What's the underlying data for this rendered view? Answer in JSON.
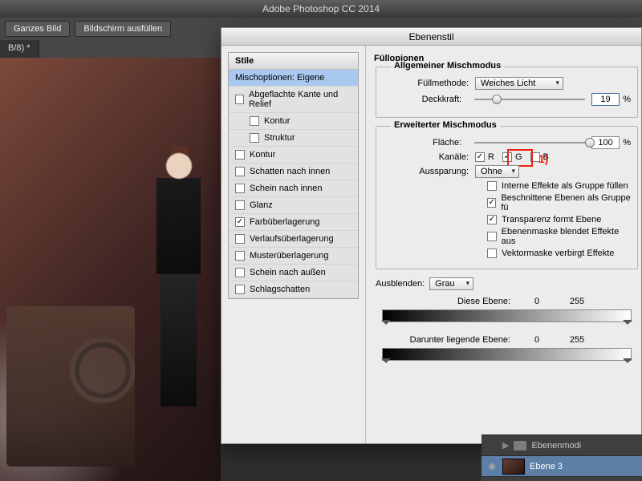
{
  "app": {
    "title": "Adobe Photoshop CC 2014"
  },
  "toolbar": {
    "ganzes_bild": "Ganzes Bild",
    "bildschirm": "Bildschirm ausfüllen"
  },
  "doc_tab": "B/8) *",
  "dialog": {
    "title": "Ebenenstil",
    "styles_header": "Stile",
    "styles": [
      {
        "label": "Mischoptionen: Eigene",
        "checked": null,
        "selected": true,
        "indent": 0
      },
      {
        "label": "Abgeflachte Kante und Relief",
        "checked": false,
        "indent": 0
      },
      {
        "label": "Kontur",
        "checked": false,
        "indent": 1
      },
      {
        "label": "Struktur",
        "checked": false,
        "indent": 1
      },
      {
        "label": "Kontur",
        "checked": false,
        "indent": 0
      },
      {
        "label": "Schatten nach innen",
        "checked": false,
        "indent": 0
      },
      {
        "label": "Schein nach innen",
        "checked": false,
        "indent": 0
      },
      {
        "label": "Glanz",
        "checked": false,
        "indent": 0
      },
      {
        "label": "Farbüberlagerung",
        "checked": true,
        "indent": 0
      },
      {
        "label": "Verlaufsüberlagerung",
        "checked": false,
        "indent": 0
      },
      {
        "label": "Musterüberlagerung",
        "checked": false,
        "indent": 0
      },
      {
        "label": "Schein nach außen",
        "checked": false,
        "indent": 0
      },
      {
        "label": "Schlagschatten",
        "checked": false,
        "indent": 0
      }
    ],
    "fill_options_title": "Füllopionen",
    "general_blend_title": "Allgemeiner Mischmodus",
    "blend_mode_label": "Füllmethode:",
    "blend_mode_value": "Weiches Licht",
    "opacity_label": "Deckkraft:",
    "opacity_value": "19",
    "advanced_blend_title": "Erweiterter Mischmodus",
    "fill_label": "Fläche:",
    "fill_value": "100",
    "channels_label": "Kanäle:",
    "channel_r": "R",
    "channel_g": "G",
    "channel_b": "B",
    "channels": {
      "r": true,
      "g": true,
      "b": false
    },
    "knockout_label": "Aussparung:",
    "knockout_value": "Ohne",
    "adv_checks": [
      {
        "label": "Interne Effekte als Gruppe füllen",
        "checked": false
      },
      {
        "label": "Beschnittene Ebenen als Gruppe fü",
        "checked": true
      },
      {
        "label": "Transparenz formt Ebene",
        "checked": true
      },
      {
        "label": "Ebenenmaske blendet Effekte aus",
        "checked": false
      },
      {
        "label": "Vektormaske verbirgt Effekte",
        "checked": false
      }
    ],
    "blend_if_label": "Ausblenden:",
    "blend_if_value": "Grau",
    "this_layer_label": "Diese Ebene:",
    "under_layer_label": "Darunter liegende Ebene:",
    "range_min": "0",
    "range_max": "255",
    "annotation": "1)"
  },
  "layers_panel": {
    "group_name": "Ebenenmodi",
    "layer_name": "Ebene 3"
  }
}
